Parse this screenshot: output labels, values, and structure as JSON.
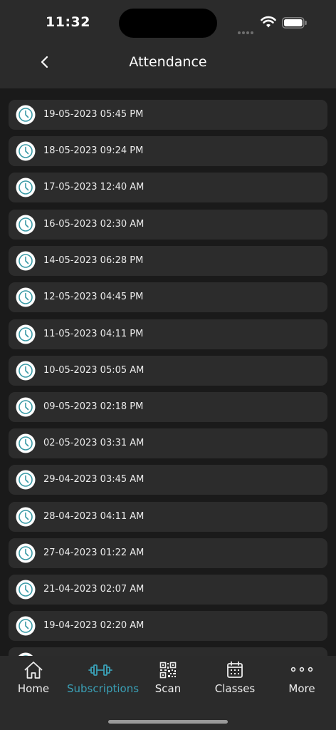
{
  "status_bar": {
    "time": "11:32"
  },
  "header": {
    "title": "Attendance"
  },
  "attendance": [
    "19-05-2023 05:45 PM",
    "18-05-2023 09:24 PM",
    "17-05-2023 12:40 AM",
    "16-05-2023 02:30 AM",
    "14-05-2023 06:28 PM",
    "12-05-2023 04:45 PM",
    "11-05-2023 04:11 PM",
    "10-05-2023 05:05 AM",
    "09-05-2023 02:18 PM",
    "02-05-2023 03:31 AM",
    "29-04-2023 03:45 AM",
    "28-04-2023 04:11 AM",
    "27-04-2023 01:22 AM",
    "21-04-2023 02:07 AM",
    "19-04-2023 02:20 AM"
  ],
  "tabs": [
    {
      "label": "Home",
      "icon": "home-icon"
    },
    {
      "label": "Subscriptions",
      "icon": "dumbbell-icon",
      "active": true
    },
    {
      "label": "Scan",
      "icon": "qr-code-icon"
    },
    {
      "label": "Classes",
      "icon": "calendar-icon"
    },
    {
      "label": "More",
      "icon": "more-dots-icon"
    }
  ],
  "colors": {
    "accent": "#3a9fb5",
    "background": "#1a1a1a",
    "surface": "#2c2c2c",
    "bar": "#2b2b2b",
    "clock_teal": "#3a9aa6"
  }
}
